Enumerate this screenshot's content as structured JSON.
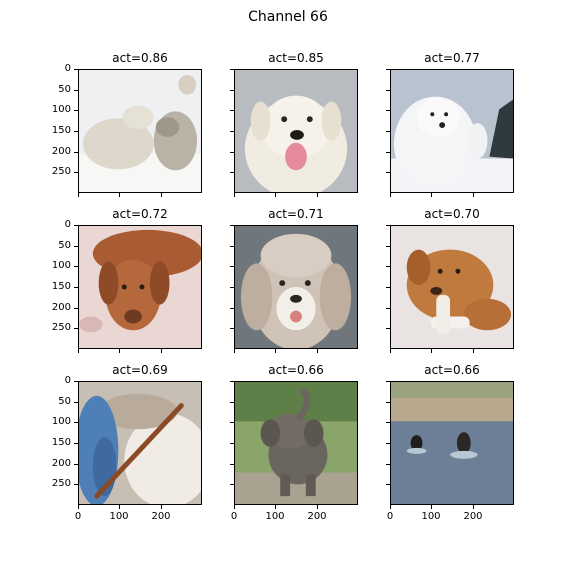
{
  "chart_data": {
    "type": "image_grid",
    "title": "Channel 66",
    "rows": 3,
    "cols": 3,
    "panels": [
      {
        "title": "act=0.86",
        "subject": "arctic wolves in snow"
      },
      {
        "title": "act=0.85",
        "subject": "white retriever dog"
      },
      {
        "title": "act=0.77",
        "subject": "samoyed dogs in snow"
      },
      {
        "title": "act=0.72",
        "subject": "vizsla dogs on blanket"
      },
      {
        "title": "act=0.71",
        "subject": "poodle dog"
      },
      {
        "title": "act=0.70",
        "subject": "puppy chewing bone"
      },
      {
        "title": "act=0.69",
        "subject": "wool yarn and knitting needle"
      },
      {
        "title": "act=0.66",
        "subject": "baby elephant"
      },
      {
        "title": "act=0.66",
        "subject": "dogs running in water"
      }
    ],
    "yticks": [
      "0",
      "50",
      "100",
      "150",
      "200",
      "250"
    ],
    "xticks": [
      "0",
      "100",
      "200"
    ],
    "ylim": [
      300,
      0
    ],
    "xlim": [
      0,
      300
    ]
  }
}
